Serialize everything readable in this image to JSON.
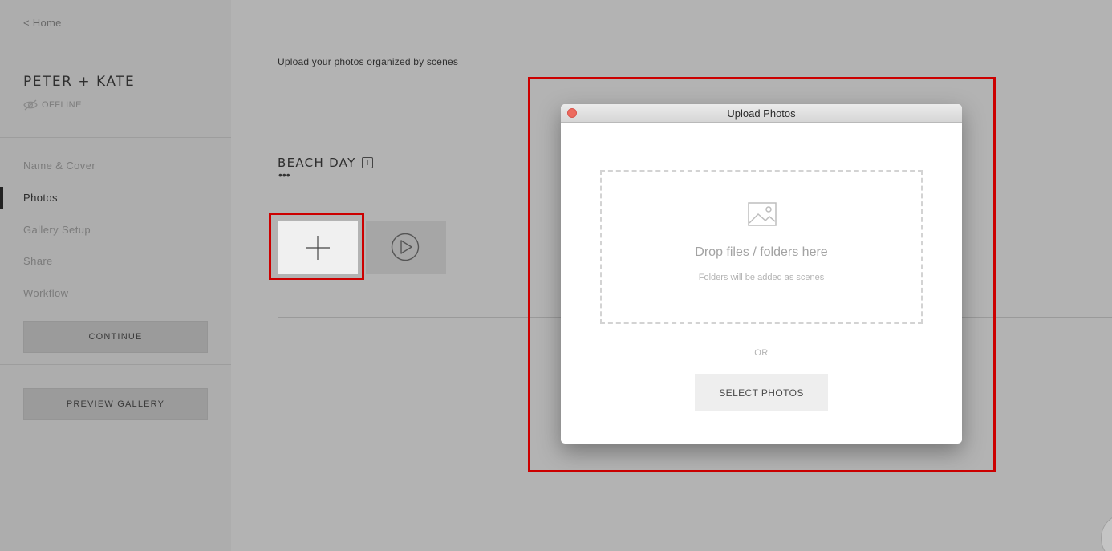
{
  "sidebar": {
    "back_label": "< Home",
    "gallery_title": "PETER + KATE",
    "status": "OFFLINE",
    "nav": [
      {
        "label": "Name & Cover",
        "active": false
      },
      {
        "label": "Photos",
        "active": true
      },
      {
        "label": "Gallery Setup",
        "active": false
      },
      {
        "label": "Share",
        "active": false
      },
      {
        "label": "Workflow",
        "active": false
      }
    ],
    "continue_label": "CONTINUE",
    "preview_label": "PREVIEW GALLERY"
  },
  "main": {
    "subtitle": "Upload your photos organized by scenes",
    "scene_title": "BEACH DAY",
    "scene_menu": "•••",
    "text_icon_label": "T"
  },
  "dialog": {
    "title": "Upload Photos",
    "drop_main": "Drop files / folders here",
    "drop_sub": "Folders will be added as scenes",
    "or_label": "OR",
    "select_label": "SELECT PHOTOS"
  },
  "colors": {
    "highlight": "#cc0000",
    "close_button": "#ec6b5f"
  }
}
